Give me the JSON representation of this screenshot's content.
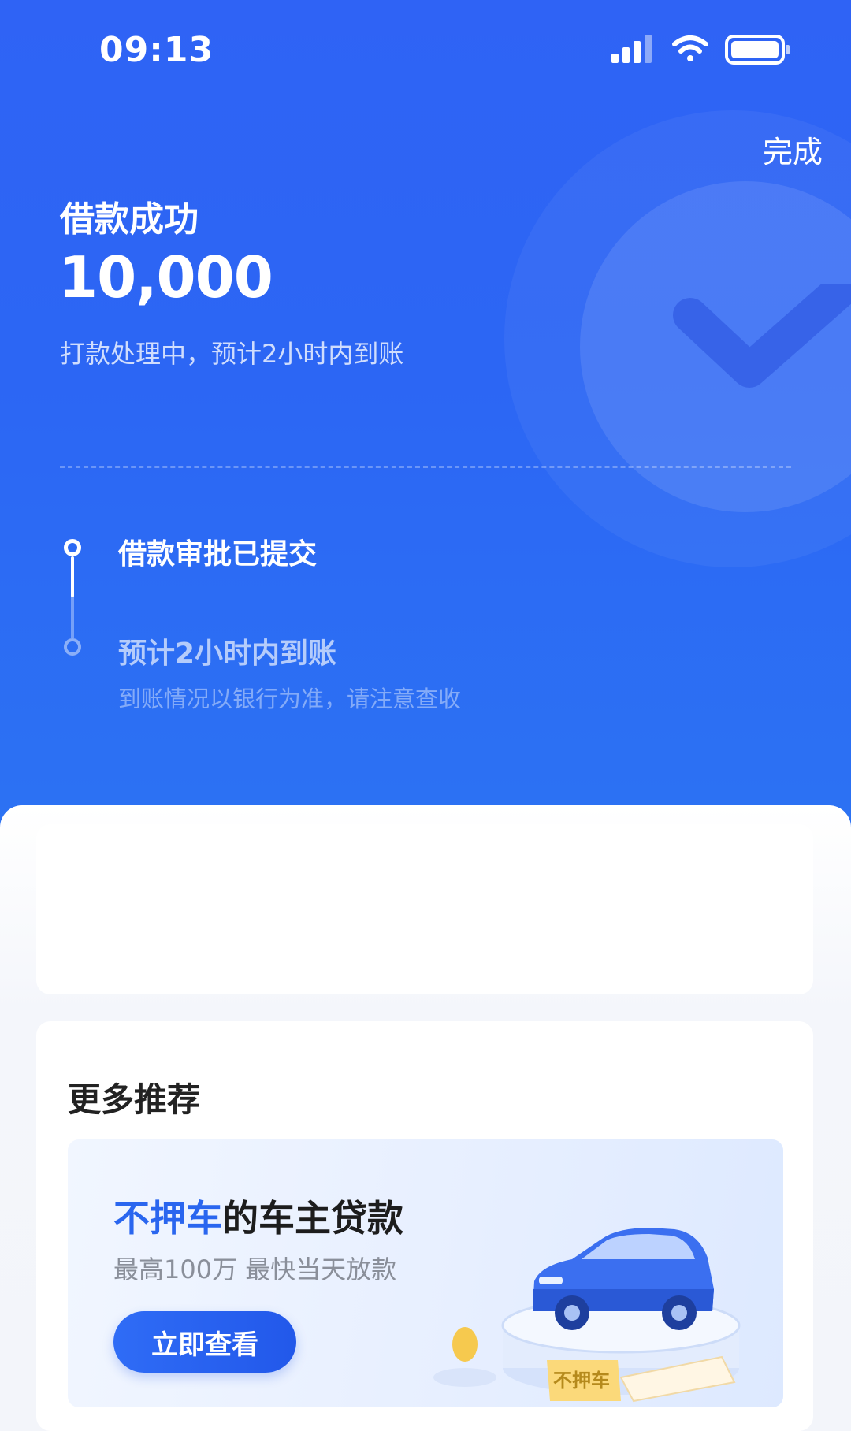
{
  "status_bar": {
    "time": "09:13"
  },
  "header": {
    "done_label": "完成"
  },
  "result": {
    "title": "借款成功",
    "amount": "10,000",
    "processing_text": "打款处理中，预计2小时内到账"
  },
  "timeline": {
    "step1": "借款审批已提交",
    "step2": "预计2小时内到账",
    "step2_note": "到账情况以银行为准，请注意查收"
  },
  "recommend": {
    "section_title": "更多推荐",
    "promo": {
      "title_highlight": "不押车",
      "title_rest": "的车主贷款",
      "subtitle": "最高100万 最快当天放款",
      "button_label": "立即查看",
      "tag_label": "不押车"
    }
  },
  "colors": {
    "primary_blue": "#2f63f5",
    "highlight_blue": "#2a66ef",
    "page_bg": "#f3f5fa"
  }
}
